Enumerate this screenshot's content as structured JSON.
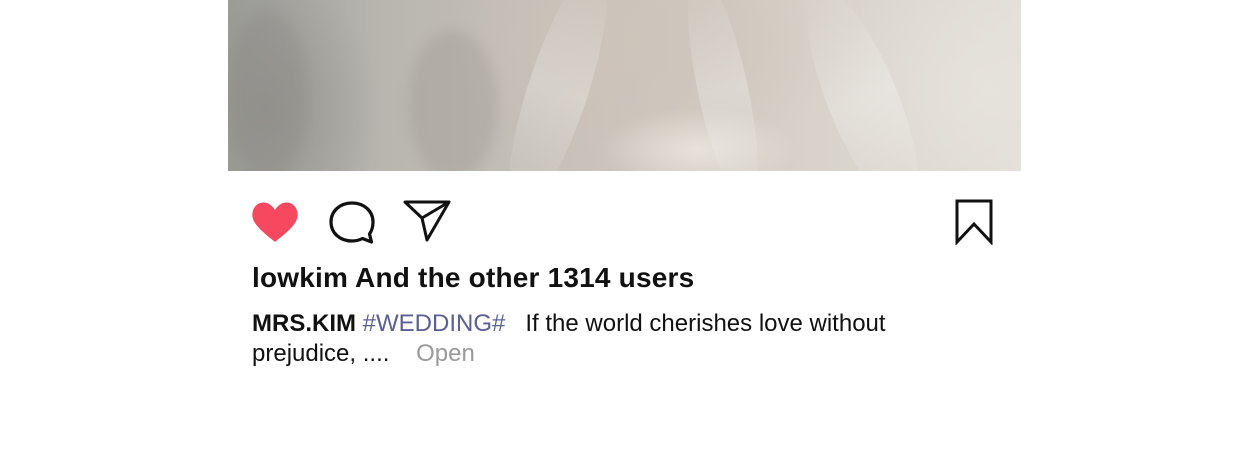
{
  "post": {
    "image": {
      "description": "wedding dress lace and tulle"
    },
    "actions": {
      "like_icon": "heart-filled-icon",
      "comment_icon": "speech-bubble-icon",
      "share_icon": "paper-plane-icon",
      "save_icon": "bookmark-icon",
      "like_color": "#f6485f"
    },
    "likes_text": "lowkim And the other 1314 users",
    "caption": {
      "author": "MRS.KIM",
      "hashtag": "#WEDDING#",
      "text": "If the world cherishes love without prejudice, ....",
      "more_label": "Open",
      "hashtag_color": "#5a5f94",
      "more_color": "#9a9a9a"
    }
  }
}
